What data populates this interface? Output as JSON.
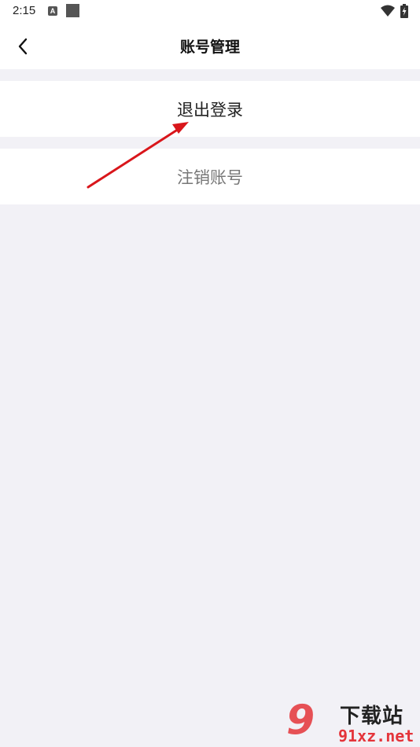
{
  "status_bar": {
    "time": "2:15",
    "notification_badge": "A",
    "icons": [
      "notification-a-icon",
      "square-notification-icon",
      "wifi-icon",
      "battery-icon"
    ]
  },
  "header": {
    "title": "账号管理",
    "back_icon": "chevron-left-icon"
  },
  "menu": {
    "logout_label": "退出登录",
    "cancel_account_label": "注销账号"
  },
  "annotation": {
    "type": "red-arrow",
    "color": "#d9161b"
  },
  "watermark": {
    "logo": "9",
    "title": "下载站",
    "url": "91xz.net"
  },
  "colors": {
    "background": "#f2f1f6",
    "surface": "#ffffff",
    "primary_text": "#222222",
    "secondary_text": "#777777",
    "accent_red": "#e4343a"
  }
}
